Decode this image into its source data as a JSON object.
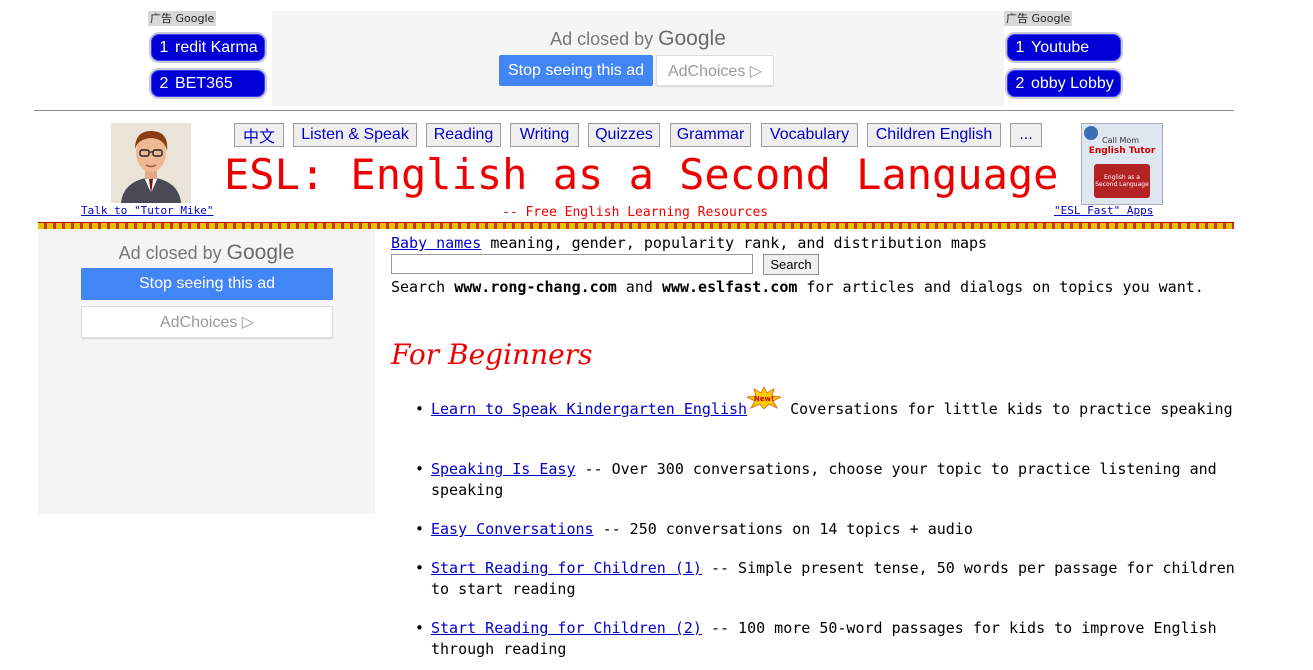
{
  "top_ads": {
    "left_label": "广告 Google",
    "left_pills": [
      {
        "num": "1",
        "text": "redit Karma"
      },
      {
        "num": "2",
        "text": "BET365"
      }
    ],
    "right_label": "广告 Google",
    "right_pills": [
      {
        "num": "1",
        "text": "Youtube"
      },
      {
        "num": "2",
        "text": "obby Lobby"
      }
    ],
    "center_ad": {
      "closed_prefix": "Ad closed by",
      "closed_brand": "Google",
      "stop_label": "Stop seeing this ad",
      "choices_label": "AdChoices ▷"
    }
  },
  "header": {
    "nav": [
      "中文",
      "Listen & Speak",
      "Reading",
      "Writing",
      "Quizzes",
      "Grammar",
      "Vocabulary",
      "Children English",
      "..."
    ],
    "title": "ESL: English as a Second Language",
    "subtitle": "-- Free English Learning Resources",
    "left_link": "Talk to \"Tutor Mike\"",
    "right_link": "\"ESL Fast\" Apps",
    "right_img_text": [
      "Call Mom",
      "English Tutor",
      "English as a Second Language"
    ]
  },
  "side_ad": {
    "closed_prefix": "Ad closed by",
    "closed_brand": "Google",
    "stop_label": "Stop seeing this ad",
    "choices_label": "AdChoices ▷"
  },
  "main": {
    "baby_link": "Baby names",
    "baby_text": " meaning, gender, popularity rank, and distribution maps",
    "search_button": "Search",
    "search_value": "",
    "search_note_prefix": "Search ",
    "search_site1": "www.rong-chang.com",
    "search_note_mid": " and ",
    "search_site2": "www.eslfast.com",
    "search_note_suffix": " for articles and dialogs on topics you want.",
    "section_title": "For Beginners",
    "new_badge": "New!",
    "items": [
      {
        "link": "Learn to Speak Kindergarten English",
        "desc": " Coversations for little kids to practice speaking"
      },
      {
        "link": "Speaking Is Easy",
        "desc": " -- Over 300 conversations, choose your topic to practice listening and speaking"
      },
      {
        "link": "Easy Conversations",
        "desc": " -- 250 conversations on 14 topics + audio"
      },
      {
        "link": "Start Reading for Children (1)",
        "desc": " -- Simple present tense, 50 words per passage for children to start reading"
      },
      {
        "link": "Start Reading for Children (2)",
        "desc": " -- 100 more 50-word passages for kids to improve English through reading"
      }
    ]
  },
  "colors": {
    "title_red": "#ee0000",
    "link_blue": "#0000cc",
    "google_blue": "#4285f4",
    "pill_blue": "#0000d6"
  }
}
